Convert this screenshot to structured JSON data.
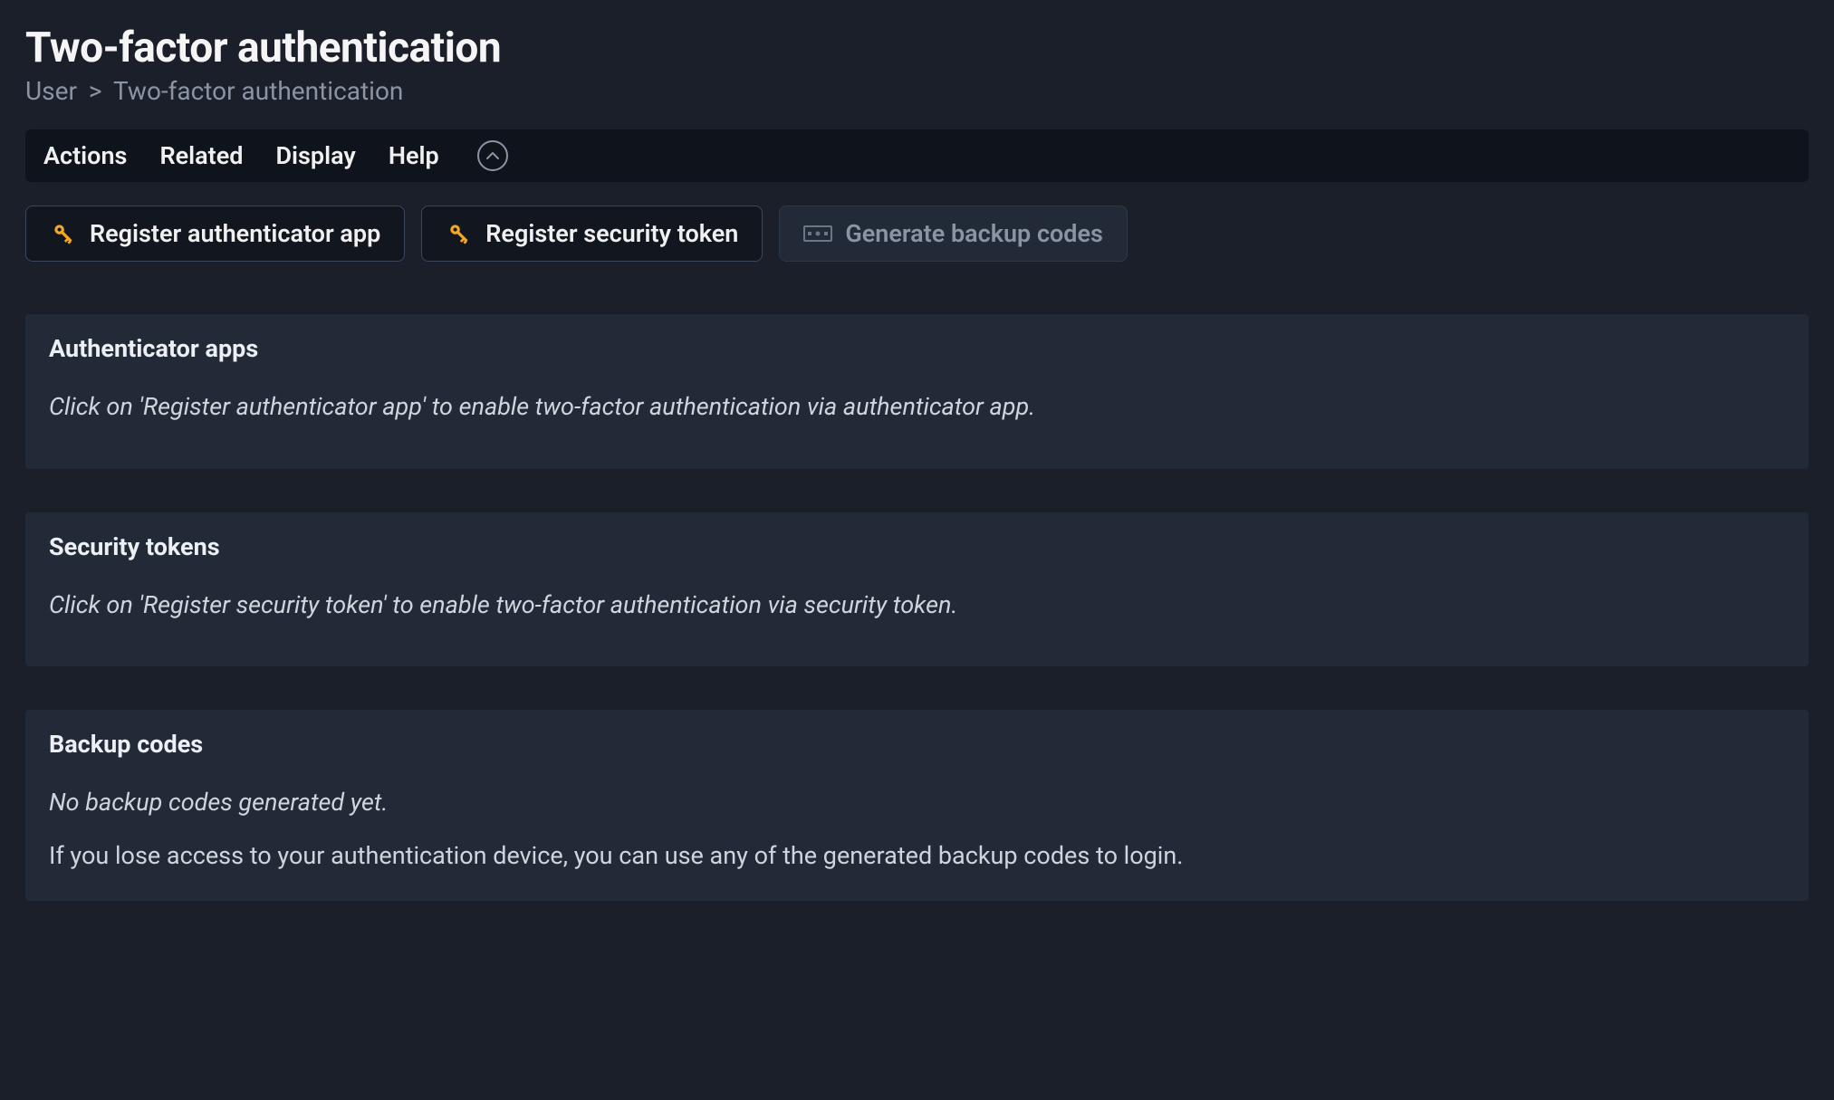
{
  "header": {
    "title": "Two-factor authentication",
    "breadcrumb_root": "User",
    "breadcrumb_current": "Two-factor authentication"
  },
  "menubar": {
    "actions": "Actions",
    "related": "Related",
    "display": "Display",
    "help": "Help"
  },
  "actions": {
    "register_authenticator": "Register authenticator app",
    "register_token": "Register security token",
    "generate_backup": "Generate backup codes"
  },
  "sections": {
    "authenticator": {
      "title": "Authenticator apps",
      "body": "Click on 'Register authenticator app' to enable two-factor authentication via authenticator app."
    },
    "tokens": {
      "title": "Security tokens",
      "body": "Click on 'Register security token' to enable two-factor authentication via security token."
    },
    "backup": {
      "title": "Backup codes",
      "empty": "No backup codes generated yet.",
      "info": "If you lose access to your authentication device, you can use any of the generated backup codes to login."
    }
  }
}
